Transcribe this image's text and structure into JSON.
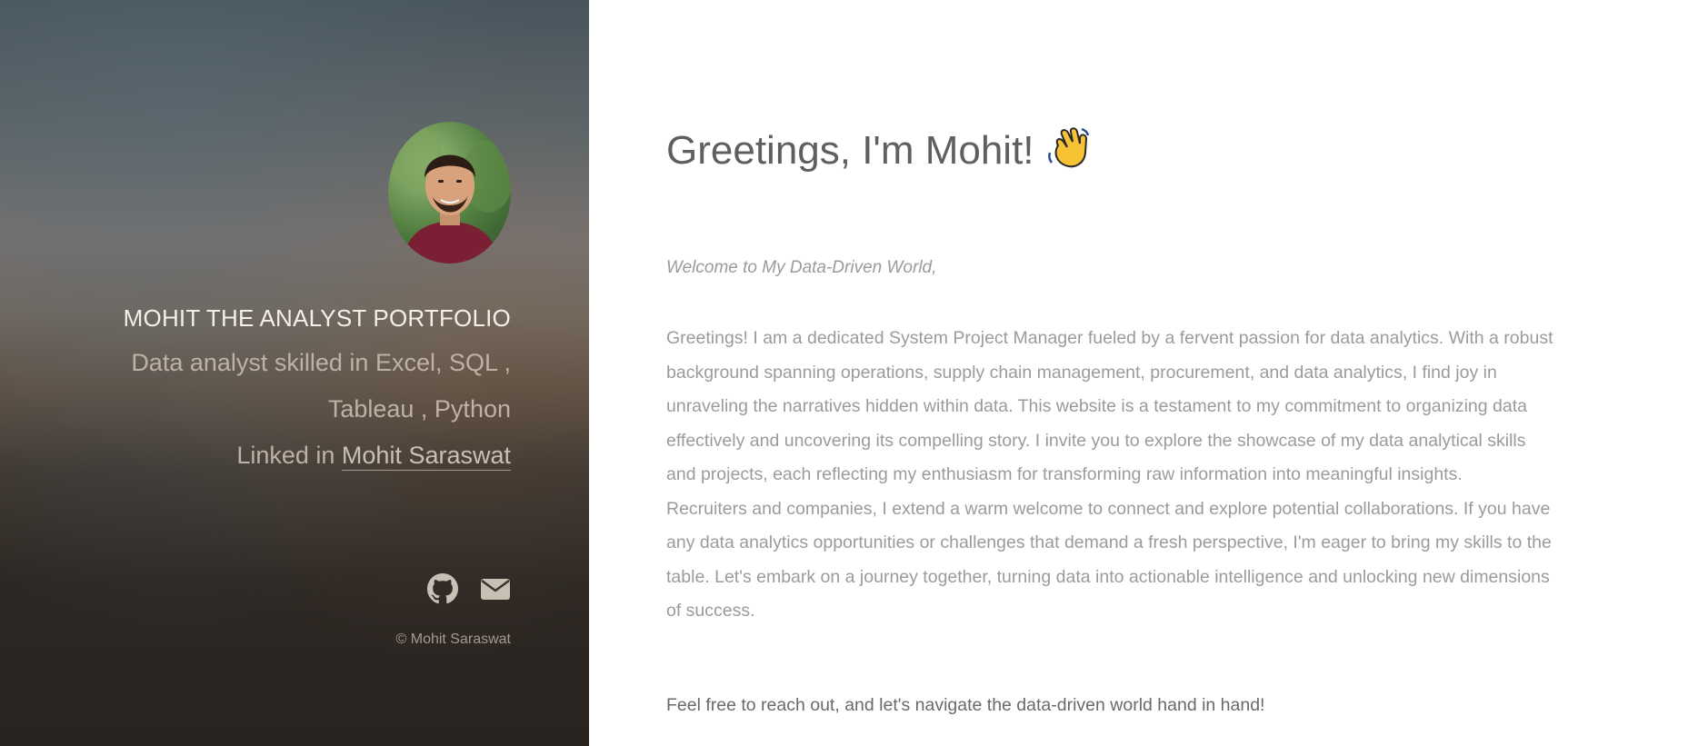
{
  "sidebar": {
    "title": "MOHIT THE ANALYST PORTFOLIO",
    "description_line1": "Data analyst skilled in Excel, SQL ,",
    "description_line2": "Tableau , Python",
    "linked_prefix": "Linked in ",
    "linked_name": "Mohit Saraswat",
    "social": [
      "github-icon",
      "envelope-icon"
    ],
    "copyright": "© Mohit Saraswat"
  },
  "main": {
    "greeting": "Greetings, I'm Mohit!",
    "welcome": "Welcome to My Data-Driven World,",
    "paragraph1": "Greetings! I am a dedicated System Project Manager fueled by a fervent passion for data analytics. With a robust background spanning operations, supply chain management, procurement, and data analytics, I find joy in unraveling the narratives hidden within data. This website is a testament to my commitment to organizing data effectively and uncovering its compelling story. I invite you to explore the showcase of my data analytical skills and projects, each reflecting my enthusiasm for transforming raw information into meaningful insights.",
    "paragraph2": "Recruiters and companies, I extend a warm welcome to connect and explore potential collaborations. If you have any data analytics opportunities or challenges that demand a fresh perspective, I'm eager to bring my skills to the table. Let's embark on a journey together, turning data into actionable intelligence and unlocking new dimensions of success.",
    "closing": "Feel free to reach out, and let's navigate the data-driven world hand in hand!"
  }
}
